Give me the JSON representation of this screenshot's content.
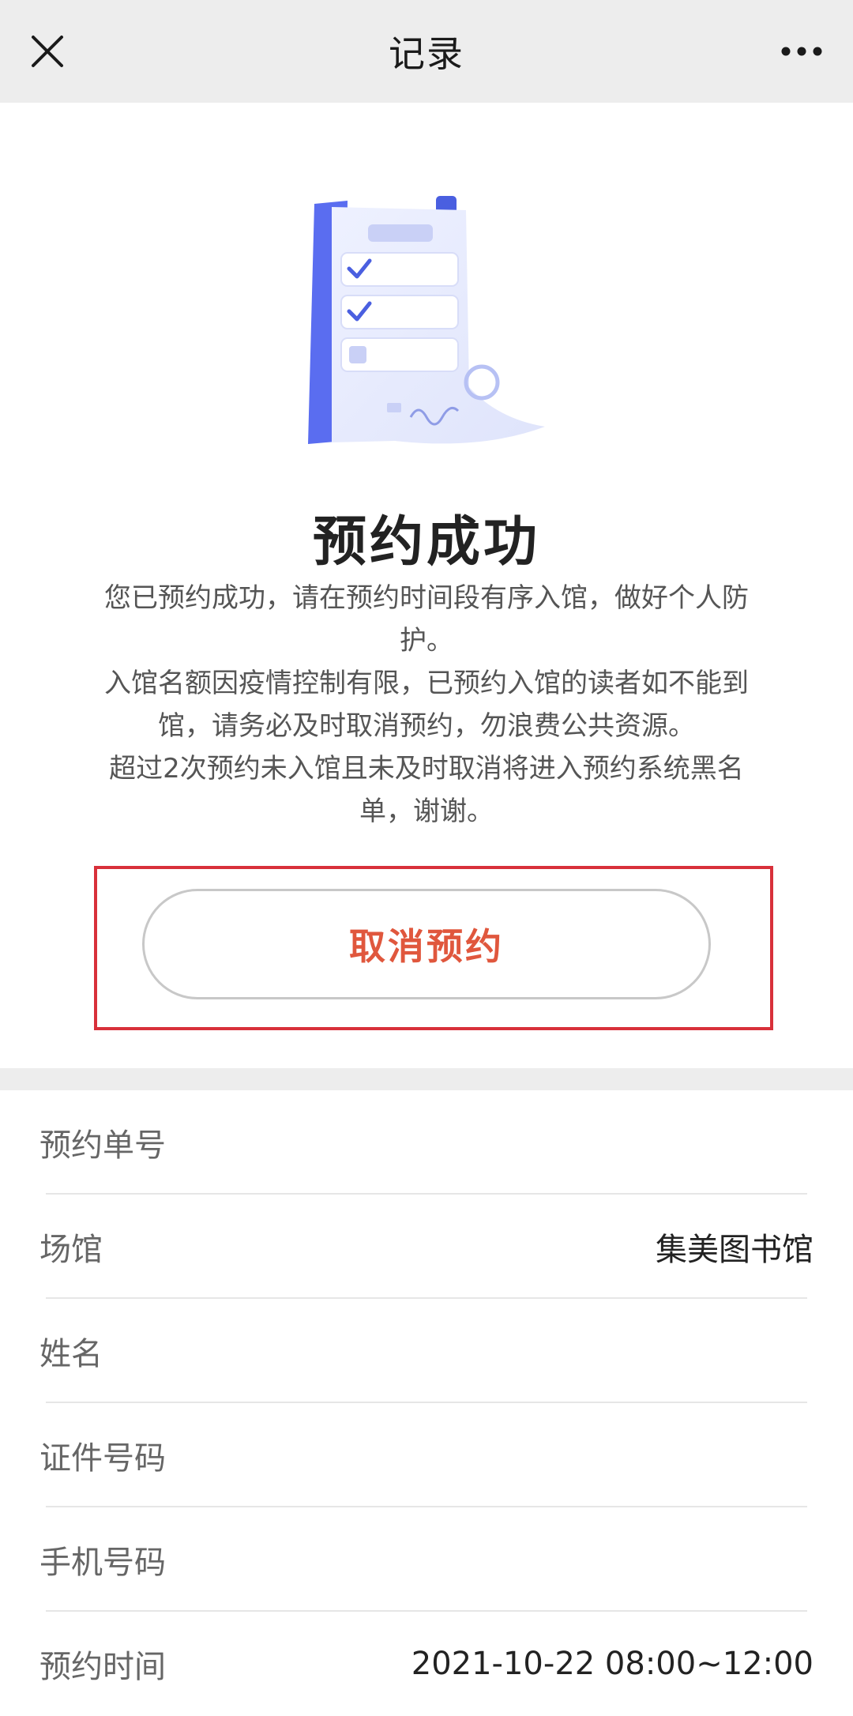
{
  "header": {
    "title": "记录",
    "close_icon": "close-icon",
    "more_icon": "more-dots-icon"
  },
  "result": {
    "title": "预约成功",
    "illustration_icon": "document-checklist-icon",
    "description": [
      "您已预约成功，请在预约时间段有序入馆，做好个人防护。",
      "入馆名额因疫情控制有限，已预约入馆的读者如不能到馆，请务必及时取消预约，勿浪费公共资源。",
      "超过2次预约未入馆且未及时取消将进入预约系统黑名单，谢谢。"
    ],
    "cancel_button": "取消预约"
  },
  "details": [
    {
      "label": "预约单号",
      "value": ""
    },
    {
      "label": "场馆",
      "value": "集美图书馆"
    },
    {
      "label": "姓名",
      "value": ""
    },
    {
      "label": "证件号码",
      "value": ""
    },
    {
      "label": "手机号码",
      "value": ""
    },
    {
      "label": "预约时间",
      "value": "2021-10-22 08:00~12:00"
    }
  ],
  "colors": {
    "accent": "#e0573d",
    "highlight_frame": "#d8303a",
    "navbar_bg": "#ededed",
    "illustration_blue": "#4a5fe0"
  }
}
